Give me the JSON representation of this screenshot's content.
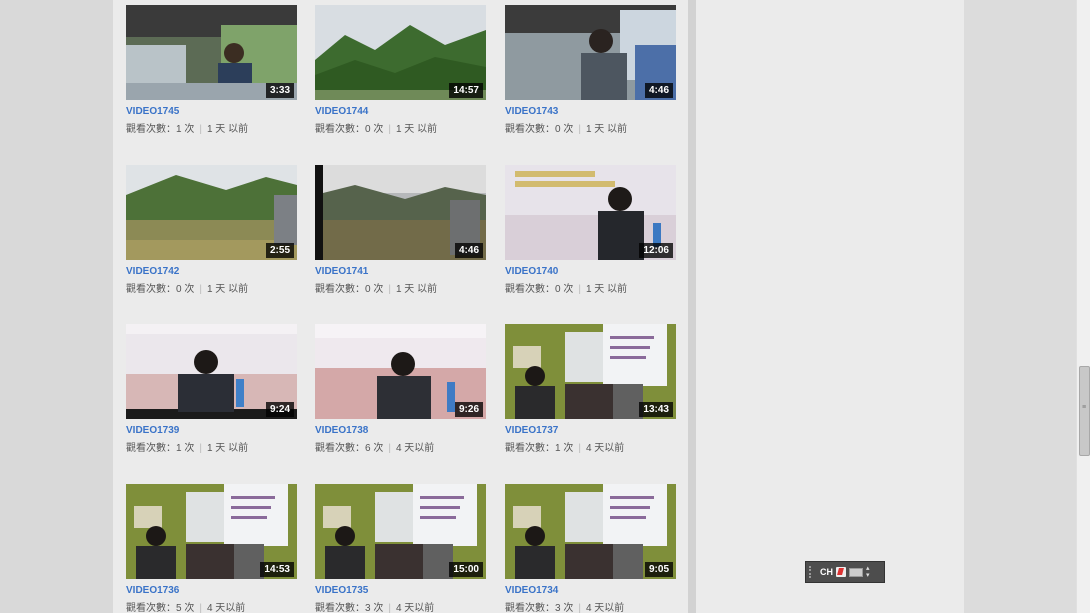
{
  "videos": [
    {
      "title": "VIDEO1745",
      "duration": "3:33",
      "views_label": "觀看次數：1 次",
      "age": "1 天 以前",
      "scene": "bus"
    },
    {
      "title": "VIDEO1744",
      "duration": "14:57",
      "views_label": "觀看次數：0 次",
      "age": "1 天 以前",
      "scene": "forest"
    },
    {
      "title": "VIDEO1743",
      "duration": "4:46",
      "views_label": "觀看次數：0 次",
      "age": "1 天 以前",
      "scene": "bus2"
    },
    {
      "title": "VIDEO1742",
      "duration": "2:55",
      "views_label": "觀看次數：0 次",
      "age": "1 天 以前",
      "scene": "hills"
    },
    {
      "title": "VIDEO1741",
      "duration": "4:46",
      "views_label": "觀看次數：0 次",
      "age": "1 天 以前",
      "scene": "valley"
    },
    {
      "title": "VIDEO1740",
      "duration": "12:06",
      "views_label": "觀看次數：0 次",
      "age": "1 天 以前",
      "scene": "speaker1"
    },
    {
      "title": "VIDEO1739",
      "duration": "9:24",
      "views_label": "觀看次數：1 次",
      "age": "1 天 以前",
      "scene": "speaker2"
    },
    {
      "title": "VIDEO1738",
      "duration": "9:26",
      "views_label": "觀看次數：6 次",
      "age": "4 天以前",
      "scene": "speaker3"
    },
    {
      "title": "VIDEO1737",
      "duration": "13:43",
      "views_label": "觀看次數：1 次",
      "age": "4 天以前",
      "scene": "podium"
    },
    {
      "title": "VIDEO1736",
      "duration": "14:53",
      "views_label": "觀看次數：5 次",
      "age": "4 天以前",
      "scene": "podium"
    },
    {
      "title": "VIDEO1735",
      "duration": "15:00",
      "views_label": "觀看次數：3 次",
      "age": "4 天以前",
      "scene": "podium"
    },
    {
      "title": "VIDEO1734",
      "duration": "9:05",
      "views_label": "觀看次數：3 次",
      "age": "4 天以前",
      "scene": "podium"
    }
  ],
  "ime_bar": {
    "language": "CH"
  },
  "colors": {
    "link": "#3a73c8",
    "duration_bg": "#000000"
  }
}
